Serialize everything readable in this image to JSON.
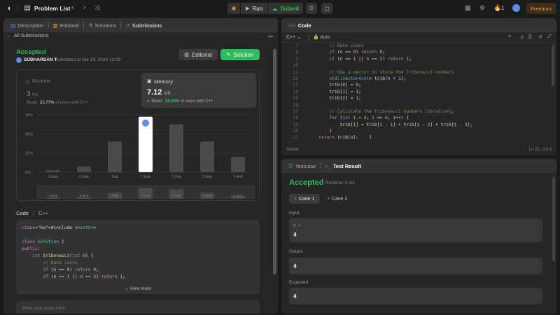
{
  "topbar": {
    "problem_list": "Problem List",
    "run": "Run",
    "submit": "Submit",
    "streak_count": "1",
    "premium": "Premium"
  },
  "left_tabs": [
    "Description",
    "Editorial",
    "Solutions",
    "Submissions"
  ],
  "submission": {
    "back_label": "All Submissions",
    "status": "Accepted",
    "user": "SUDHARSAN T",
    "submitted_text": "submitted at Apr 24, 2024 12:09",
    "editorial_btn": "Editorial",
    "solution_btn": "Solution",
    "runtime_label": "Runtime",
    "runtime_value": "3",
    "runtime_unit": "ms",
    "runtime_beats": "Beats",
    "runtime_pct": "22.77%",
    "runtime_beats_suffix": "of users with C++",
    "memory_label": "Memory",
    "memory_value": "7.12",
    "memory_unit": "MB",
    "memory_beats": "Beats",
    "memory_pct": "58.59%",
    "memory_beats_suffix": "of users with C++"
  },
  "chart_data": {
    "type": "bar",
    "categories": [
      "6.8mb",
      "6.9mb",
      "7mb",
      "7.1mb",
      "7.2mb",
      "7.3mb",
      "7.4mb"
    ],
    "values": [
      1,
      3,
      16,
      29,
      25,
      16,
      8
    ],
    "y_ticks": [
      "30%",
      "20%",
      "10%",
      "0%"
    ],
    "ylim": [
      0,
      30
    ],
    "highlight_index": 3,
    "highlight_color": "#ffffff",
    "bar_color": "#4a4a4a"
  },
  "code_section": {
    "title": "Code",
    "lang": "C++",
    "view_more": "View more",
    "notes_placeholder": "Write your notes here"
  },
  "code_preview": [
    "#include <vector>",
    "",
    "class Solution {",
    "public:",
    "    int tribonacci(int n) {",
    "        // Base cases",
    "        if (n == 0) return 0;",
    "        if (n == 1 || n == 2) return 1;"
  ],
  "editor": {
    "tab": "Code",
    "lang": "C++",
    "auto": "Auto",
    "saved": "Saved",
    "cursor": "Ln 22, Col 3",
    "line_numbers": [
      "7",
      "8",
      "9",
      "10",
      "11",
      "12",
      "13",
      "14",
      "15",
      "16",
      "17",
      "18",
      "19",
      "20",
      "21"
    ],
    "lines": [
      "        // Base cases",
      "        if (n == 0) return 0;",
      "        if (n == 1 || n == 2) return 1;",
      "",
      "        // Use a vector to store the Tribonacci numbers",
      "        std::vector<int> trib(n + 1);",
      "        trib[0] = 0;",
      "        trib[1] = 1;",
      "        trib[2] = 1;",
      "",
      "        // Calculate the Tribonacci numbers iteratively",
      "        for (int i = 3; i <= n; i++) {",
      "            trib[i] = trib[i - 1] + trib[i - 2] + trib[i - 3];",
      "        }",
      "    return trib[n];    }"
    ]
  },
  "result": {
    "tab_testcase": "Testcase",
    "tab_result": "Test Result",
    "status": "Accepted",
    "runtime": "Runtime: 0 ms",
    "case1": "Case 1",
    "case2": "Case 2",
    "input_label": "Input",
    "input_var": "n =",
    "input_value": "4",
    "output_label": "Output",
    "output_value": "4",
    "expected_label": "Expected",
    "expected_value": "4"
  },
  "colors": {
    "accent_green": "#2cbb5d",
    "run_green": "#28c244",
    "premium": "#ffa116",
    "link_blue": "#3e8ef7"
  }
}
